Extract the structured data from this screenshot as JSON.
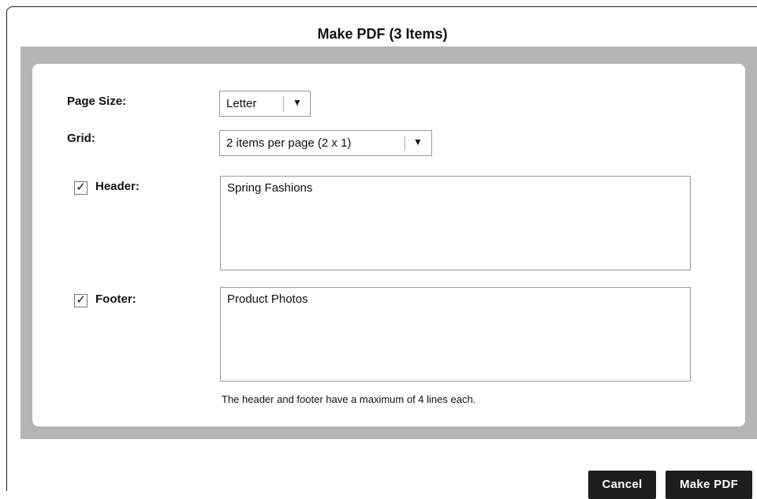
{
  "dialog": {
    "title": "Make PDF (3 Items)"
  },
  "form": {
    "page_size": {
      "label": "Page Size:",
      "value": "Letter"
    },
    "grid": {
      "label": "Grid:",
      "value": "2 items per page (2 x 1)"
    },
    "header": {
      "label": "Header:",
      "checked": true,
      "value": "Spring Fashions"
    },
    "footer": {
      "label": "Footer:",
      "checked": true,
      "value": "Product Photos"
    },
    "note": "The header and footer have a maximum of 4 lines each."
  },
  "buttons": {
    "cancel": "Cancel",
    "make_pdf": "Make PDF"
  },
  "icons": {
    "dropdown": "chevron-down-icon",
    "check": "check-icon"
  }
}
